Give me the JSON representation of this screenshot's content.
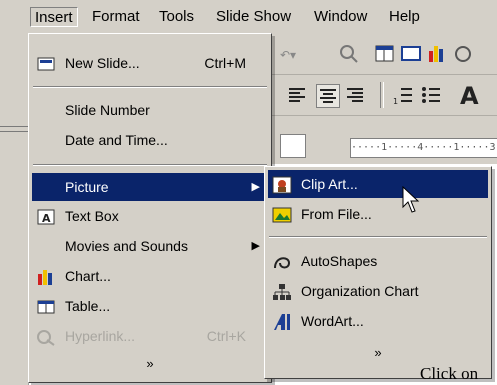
{
  "menubar": {
    "items": [
      "Insert",
      "Format",
      "Tools",
      "Slide Show",
      "Window",
      "Help"
    ]
  },
  "insert_menu": {
    "items": [
      {
        "label": "New Slide...",
        "shortcut": "Ctrl+M",
        "icon": "new-slide-icon"
      },
      {
        "label": "Slide Number"
      },
      {
        "label": "Date and Time..."
      },
      {
        "label": "Picture",
        "submenu": true
      },
      {
        "label": "Text Box",
        "icon": "text-box-icon"
      },
      {
        "label": "Movies and Sounds",
        "submenu": true
      },
      {
        "label": "Chart...",
        "icon": "chart-icon"
      },
      {
        "label": "Table...",
        "icon": "table-icon"
      },
      {
        "label": "Hyperlink...",
        "shortcut": "Ctrl+K",
        "icon": "hyperlink-icon",
        "disabled": true
      }
    ],
    "expand": "»"
  },
  "picture_submenu": {
    "items": [
      {
        "label": "Clip Art...",
        "icon": "clip-art-icon"
      },
      {
        "label": "From File...",
        "icon": "from-file-icon"
      },
      {
        "label": "AutoShapes",
        "icon": "autoshapes-icon"
      },
      {
        "label": "Organization Chart",
        "icon": "org-chart-icon"
      },
      {
        "label": "WordArt...",
        "icon": "wordart-icon"
      }
    ],
    "expand": "»"
  },
  "toolbar": {
    "ruler_text": "·····1·····4·····1·····3"
  },
  "caption": "Click on",
  "colors": {
    "face": "#d4d0c8",
    "highlight": "#0a246a",
    "disabled": "#a8a6a0"
  }
}
